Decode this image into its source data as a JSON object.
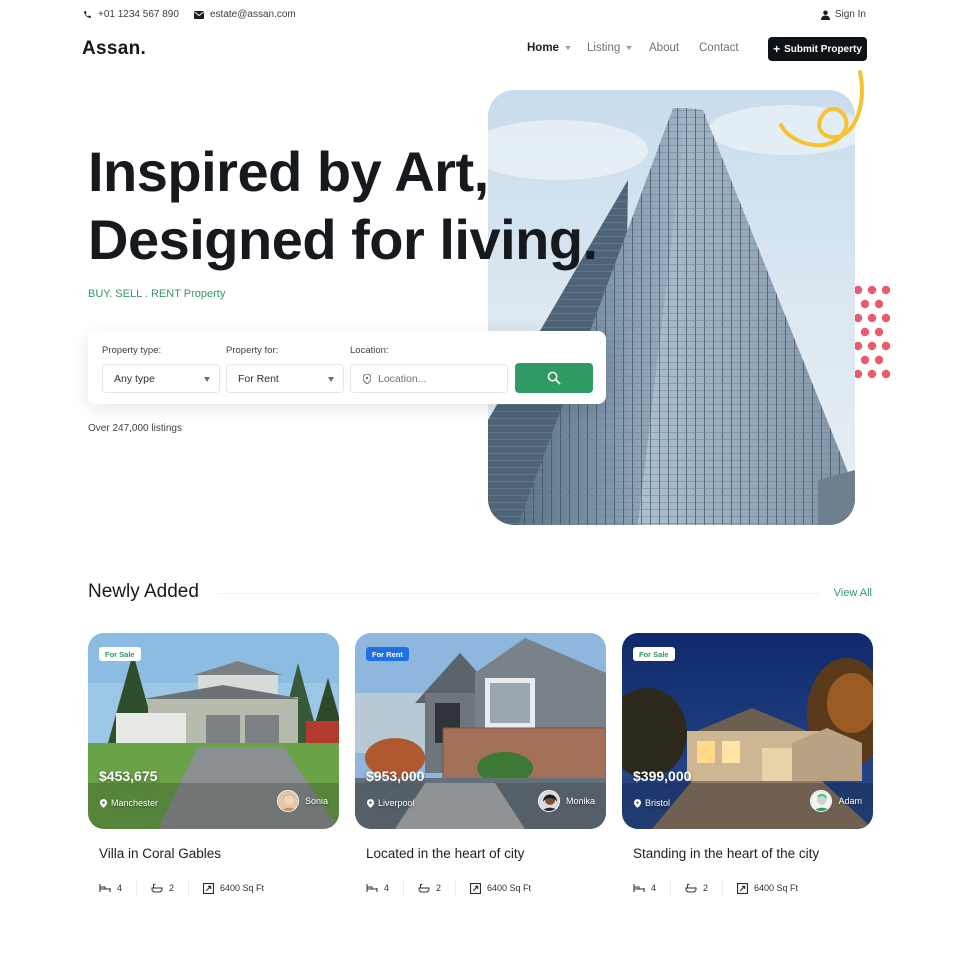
{
  "topbar": {
    "phone": "+01 1234 567 890",
    "email": "estate@assan.com",
    "sign_in": "Sign In",
    "icons": [
      "phone-icon",
      "mail-icon",
      "user-icon"
    ]
  },
  "nav": {
    "logo": "Assan.",
    "items": [
      {
        "label": "Home",
        "has_dropdown": true,
        "active": true
      },
      {
        "label": "Listing",
        "has_dropdown": true,
        "active": false
      },
      {
        "label": "About",
        "has_dropdown": false,
        "active": false
      },
      {
        "label": "Contact",
        "has_dropdown": false,
        "active": false
      }
    ],
    "cta": "Submit Property"
  },
  "hero": {
    "title_line1": "Inspired by Art,",
    "title_line2": "Designed for living.",
    "subtitle": "BUY. SELL . RENT Property"
  },
  "search": {
    "property_type_label": "Property type:",
    "property_type_value": "Any type",
    "property_for_label": "Property for:",
    "property_for_value": "For Rent",
    "location_label": "Location:",
    "location_placeholder": "Location...",
    "listings_count": "Over 247,000 listings"
  },
  "section": {
    "title": "Newly Added",
    "view_all": "View All"
  },
  "cards": [
    {
      "badge": "For Sale",
      "badge_type": "sale",
      "price": "$453,675",
      "city": "Manchester",
      "agent": "Sonia",
      "title": "Villa in Coral Gables",
      "beds": "4",
      "baths": "2",
      "area": "6400 Sq Ft"
    },
    {
      "badge": "For Rent",
      "badge_type": "rent",
      "price": "$953,000",
      "city": "Liverpool",
      "agent": "Monika",
      "title": "Located in the heart of city",
      "beds": "4",
      "baths": "2",
      "area": "6400 Sq Ft"
    },
    {
      "badge": "For Sale",
      "badge_type": "sale",
      "price": "$399,000",
      "city": "Bristol",
      "agent": "Adam",
      "title": "Standing in the heart of the city",
      "beds": "4",
      "baths": "2",
      "area": "6400 Sq Ft"
    }
  ],
  "colors": {
    "accent_green": "#2f9a63",
    "dark": "#0e1216",
    "rent_badge_blue": "#1f6fe5",
    "dot_red": "#ec5b6b",
    "squiggle_yellow": "#f5c231"
  }
}
